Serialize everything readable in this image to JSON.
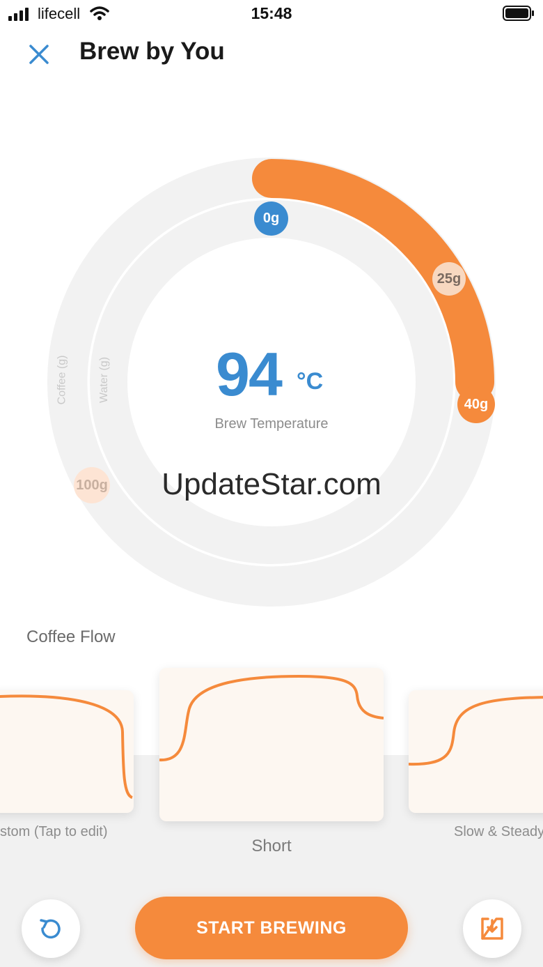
{
  "status_bar": {
    "carrier": "lifecell",
    "time": "15:48"
  },
  "header": {
    "title": "Brew by You",
    "close_icon": "close-icon"
  },
  "dial": {
    "temperature_value": "94",
    "temperature_unit": "°C",
    "temperature_label": "Brew Temperature",
    "outer_ring_label": "Coffee (g)",
    "inner_ring_label": "Water (g)",
    "markers": [
      "0g",
      "25g",
      "40g",
      "100g"
    ]
  },
  "watermark": "UpdateStar.com",
  "coffee_flow": {
    "title": "Coffee Flow",
    "profiles": [
      {
        "label": "stom (Tap to edit)"
      },
      {
        "label": "Short",
        "selected": true
      },
      {
        "label": "Slow & Steady"
      }
    ]
  },
  "actions": {
    "reset_icon": "reset-icon",
    "start_label": "START BREWING",
    "save_icon": "save-icon"
  },
  "colors": {
    "accent": "#f58a3c",
    "blue": "#3a8bd0",
    "ring": "#f2f2f2"
  }
}
